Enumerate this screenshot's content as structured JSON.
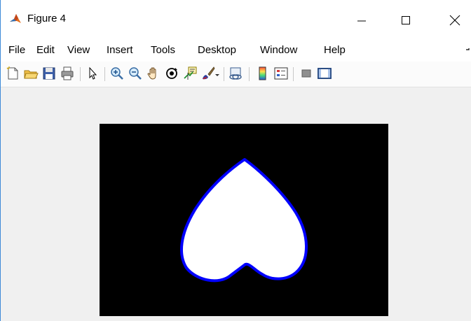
{
  "window": {
    "title": "Figure 4",
    "controls": {
      "minimize": "–",
      "maximize": "☐",
      "close": "✕"
    }
  },
  "menu": {
    "items": [
      "File",
      "Edit",
      "View",
      "Insert",
      "Tools",
      "Desktop",
      "Window",
      "Help"
    ]
  },
  "toolbar": {
    "icons": [
      "new-figure-icon",
      "open-file-icon",
      "save-icon",
      "print-icon",
      "select-pointer-icon",
      "zoom-in-icon",
      "zoom-out-icon",
      "pan-hand-icon",
      "rotate-3d-icon",
      "data-cursor-icon",
      "brush-icon",
      "dropdown-arrow-icon",
      "link-plot-icon",
      "colorbar-icon",
      "legend-icon",
      "hide-plot-tools-icon",
      "show-plot-tools-icon"
    ]
  },
  "figure": {
    "colors": {
      "axes_background": "#000000",
      "shape_fill": "#ffffff",
      "shape_outline": "#0000ff"
    }
  }
}
